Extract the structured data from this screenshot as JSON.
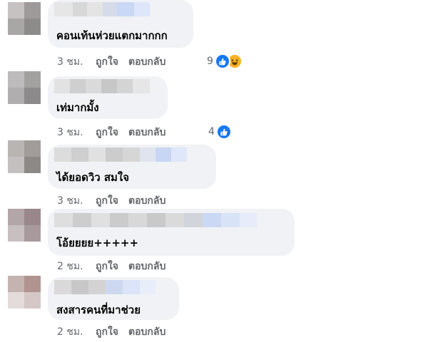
{
  "comments": [
    {
      "text": "คอนเท้นห่วยแตกมากกก",
      "time": "3 ชม.",
      "like": "ถูกใจ",
      "reply": "ตอบกลับ",
      "reactions": "9",
      "reaction_icons": [
        "like-icon",
        "haha-icon"
      ]
    },
    {
      "text": "เท่มากมั้ง",
      "time": "3 ชม.",
      "like": "ถูกใจ",
      "reply": "ตอบกลับ",
      "reactions": "4",
      "reaction_icons": [
        "like-icon"
      ]
    },
    {
      "text": "ได้ยอดวิว สมใจ",
      "time": "3 ชม.",
      "like": "ถูกใจ",
      "reply": "ตอบกลับ"
    },
    {
      "text": "โอ้ยยยย+++++",
      "time": "2 ชม.",
      "like": "ถูกใจ",
      "reply": "ตอบกลับ"
    },
    {
      "text": "สงสารคนที่มาช่วย",
      "time": "2 ชม.",
      "like": "ถูกใจ",
      "reply": "ตอบกลับ"
    }
  ],
  "colors": {
    "bubble": "#f0f2f5",
    "meta_text": "#65676b",
    "like_blue": "#1877f2",
    "haha_yellow": "#f7b125"
  }
}
